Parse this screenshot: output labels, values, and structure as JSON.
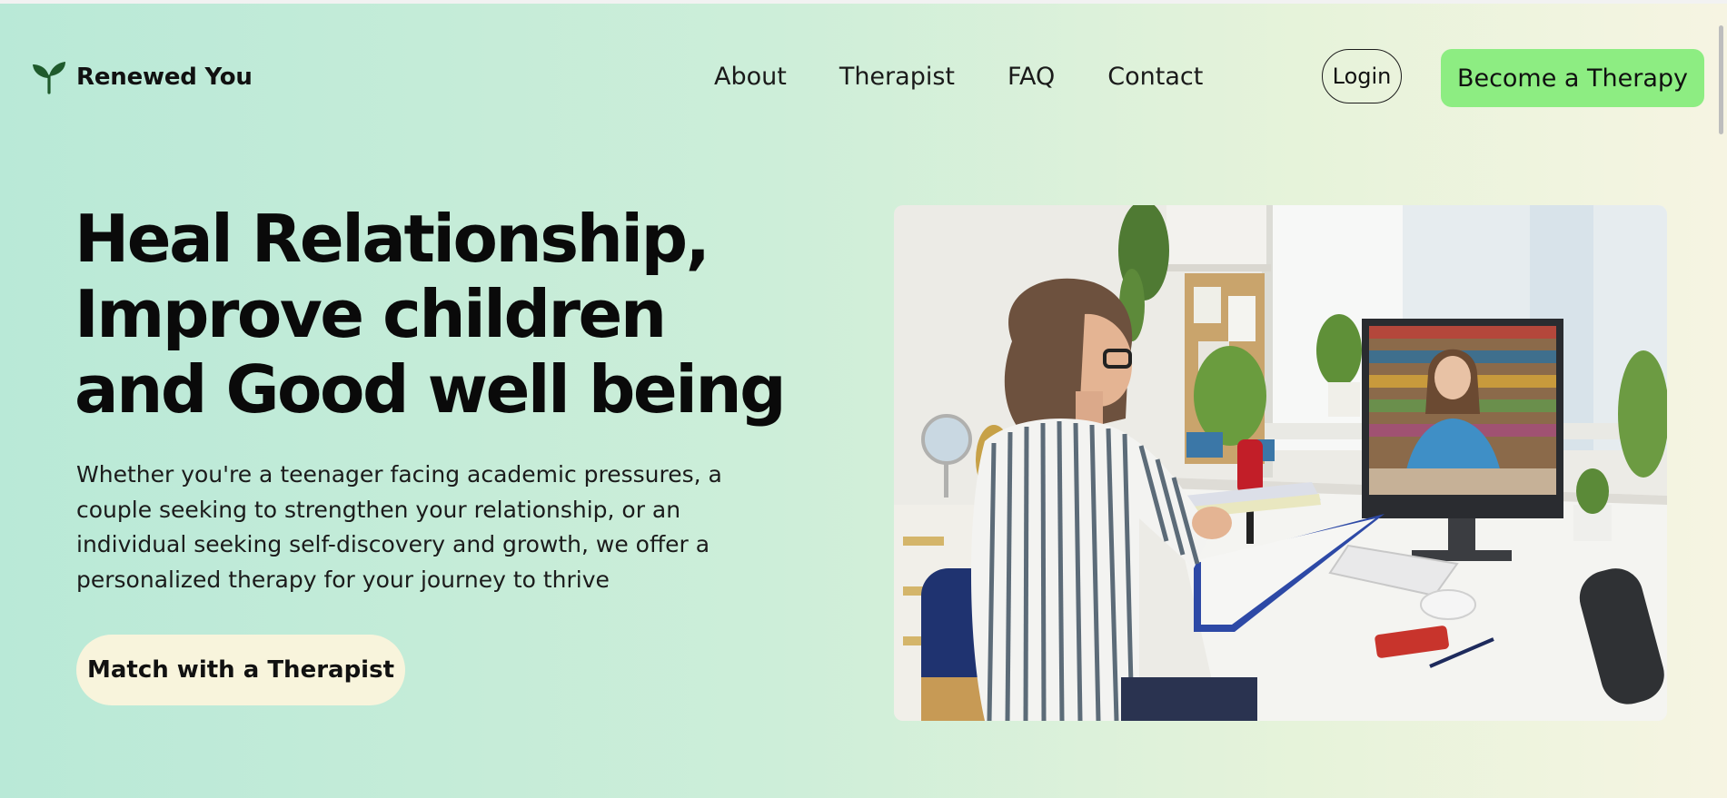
{
  "nav": {
    "brand_name": "Renewed You",
    "brand_icon": "sprout-icon",
    "links": [
      {
        "label": "About"
      },
      {
        "label": "Therapist"
      },
      {
        "label": "FAQ"
      },
      {
        "label": "Contact"
      }
    ],
    "login_label": "Login",
    "cta_label": "Become a Therapy",
    "cta_color": "#8ded82"
  },
  "hero": {
    "title_lines": [
      "Heal Relationship,",
      "Improve children",
      "and Good well being"
    ],
    "description_lines": [
      "Whether you're a teenager facing academic pressures, a",
      "couple seeking to strengthen your relationship, or an",
      "individual seeking self-discovery and growth, we offer a",
      "personalized therapy for your journey to thrive"
    ],
    "button_label": "Match with a Therapist",
    "button_color": "#f8f4dc"
  },
  "colors": {
    "background_start": "#b9e9d7",
    "background_end": "#f6f4e2",
    "text": "#0a0a0a",
    "brand_icon": "#1f5a2c"
  }
}
